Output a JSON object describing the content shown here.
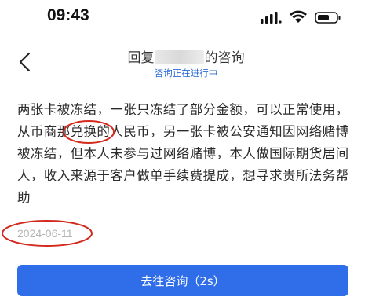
{
  "status_bar": {
    "time": "09:43"
  },
  "nav": {
    "title_prefix": "回复",
    "title_suffix": "的咨询",
    "subtitle": "咨询正在进行中"
  },
  "question": {
    "text": "两张卡被冻结，一张只冻结了部分金额，可以正常使用，从币商那兑换的人民币，另一张卡被公安通知因网络赌博被冻结，但本人未参与过网络赌博，本人做国际期货居间人，收入来源于客户做单手续费提成，想寻求贵所法务帮助",
    "date": "2024-06-11"
  },
  "actions": {
    "consult_label": "去往咨询（2s）"
  },
  "colors": {
    "accent": "#2f6ee8",
    "annotation": "#d42a1e"
  }
}
